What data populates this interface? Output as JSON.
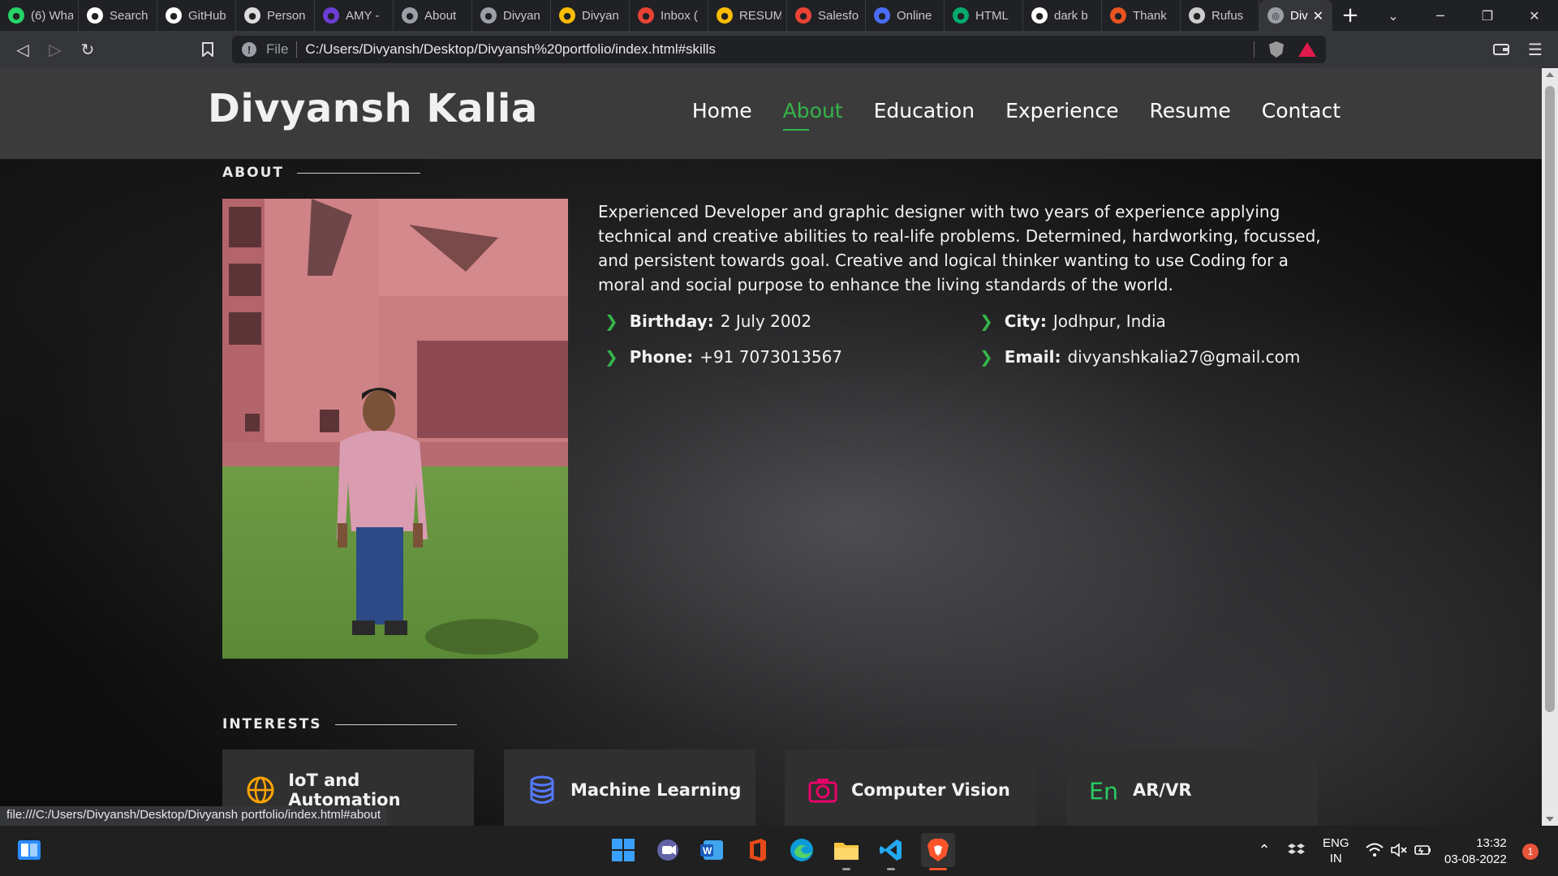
{
  "browser": {
    "tabs": [
      {
        "label": "(6) Wha",
        "icon": "whatsapp-icon",
        "color": "#25d366"
      },
      {
        "label": "Search",
        "icon": "github-icon",
        "color": "#ffffff"
      },
      {
        "label": "GitHub",
        "icon": "github-icon",
        "color": "#ffffff"
      },
      {
        "label": "Person",
        "icon": "avatar-icon",
        "color": "#dddddd"
      },
      {
        "label": "AMY -",
        "icon": "amy-icon",
        "color": "#6b3fd6"
      },
      {
        "label": "About",
        "icon": "globe-icon",
        "color": "#9aa0a6"
      },
      {
        "label": "Divyan",
        "icon": "globe-icon",
        "color": "#9aa0a6"
      },
      {
        "label": "Divyan",
        "icon": "google-drive-icon",
        "color": "#fbbc04"
      },
      {
        "label": "Inbox (",
        "icon": "gmail-icon",
        "color": "#ea4335"
      },
      {
        "label": "RESUM",
        "icon": "google-drive-icon",
        "color": "#fbbc04"
      },
      {
        "label": "Salesfo",
        "icon": "gmail-icon",
        "color": "#ea4335"
      },
      {
        "label": "Online",
        "icon": "online-icon",
        "color": "#4a6cf7"
      },
      {
        "label": "HTML",
        "icon": "w3schools-icon",
        "color": "#04aa6d"
      },
      {
        "label": "dark b",
        "icon": "google-icon",
        "color": "#ffffff"
      },
      {
        "label": "Thank",
        "icon": "ubuntu-icon",
        "color": "#e95420"
      },
      {
        "label": "Rufus",
        "icon": "usb-icon",
        "color": "#cccccc"
      }
    ],
    "active_tab": {
      "label": "Div",
      "icon": "globe-icon"
    },
    "new_tab": "+",
    "address": {
      "scheme": "File",
      "url": "C:/Users/Divyansh/Desktop/Divyansh%20portfolio/index.html#skills"
    },
    "status_url": "file:///C:/Users/Divyansh/Desktop/Divyansh portfolio/index.html#about"
  },
  "site": {
    "logo": "Divyansh Kalia",
    "nav": [
      "Home",
      "About",
      "Education",
      "Experience",
      "Resume",
      "Contact"
    ],
    "active_nav": "About",
    "accent": "#34b54a"
  },
  "about": {
    "title": "ABOUT",
    "paragraph": "Experienced Developer and graphic designer with two years of experience applying technical and creative abilities to real-life problems. Determined, hardworking, focussed, and persistent towards goal. Creative and logical thinker wanting to use Coding for a moral and social purpose to enhance the living standards of the world.",
    "facts": [
      {
        "key": "Birthday:",
        "value": "2 July 2002"
      },
      {
        "key": "City:",
        "value": "Jodhpur, India"
      },
      {
        "key": "Phone:",
        "value": "+91 7073013567"
      },
      {
        "key": "Email:",
        "value": "divyanshkalia27@gmail.com"
      }
    ]
  },
  "interests": {
    "title": "INTERESTS",
    "items": [
      {
        "label": "IoT and Automation",
        "icon": "globe-icon",
        "color": "#ffa500"
      },
      {
        "label": "Machine Learning",
        "icon": "database-icon",
        "color": "#5578ff"
      },
      {
        "label": "Computer Vision",
        "icon": "camera-icon",
        "color": "#e80368"
      },
      {
        "label": "AR/VR",
        "icon": "language-icon",
        "color": "#29cc61"
      }
    ]
  },
  "taskbar": {
    "lang": [
      "ENG",
      "IN"
    ],
    "time": "13:32",
    "date": "03-08-2022",
    "notifications": "1"
  }
}
